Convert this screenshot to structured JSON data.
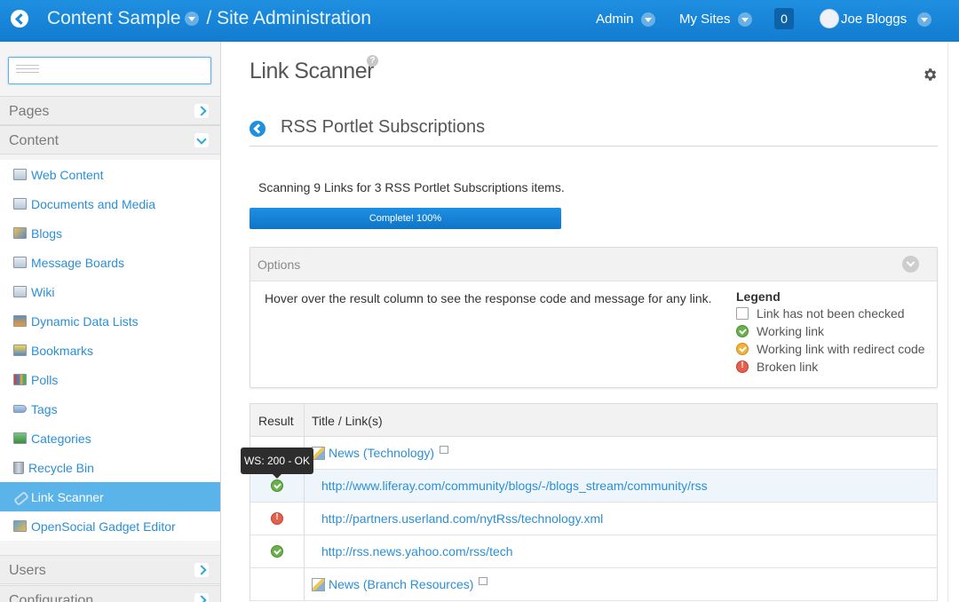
{
  "header": {
    "site_name": "Content Sample",
    "separator": "/",
    "section": "Site Administration",
    "admin_label": "Admin",
    "my_sites_label": "My Sites",
    "notification_count": "0",
    "user_name": "Joe Bloggs",
    "bar_color": "#1688d9"
  },
  "sidebar": {
    "search": {
      "value": "",
      "placeholder": ""
    },
    "pages_label": "Pages",
    "content_label": "Content",
    "content_items": [
      {
        "label": "Web Content",
        "icon": "web-content-icon"
      },
      {
        "label": "Documents and Media",
        "icon": "documents-icon"
      },
      {
        "label": "Blogs",
        "icon": "blogs-icon"
      },
      {
        "label": "Message Boards",
        "icon": "message-boards-icon"
      },
      {
        "label": "Wiki",
        "icon": "wiki-icon"
      },
      {
        "label": "Dynamic Data Lists",
        "icon": "dynamic-data-lists-icon"
      },
      {
        "label": "Bookmarks",
        "icon": "bookmarks-icon"
      },
      {
        "label": "Polls",
        "icon": "polls-icon"
      },
      {
        "label": "Tags",
        "icon": "tags-icon"
      },
      {
        "label": "Categories",
        "icon": "categories-icon"
      },
      {
        "label": "Recycle Bin",
        "icon": "recycle-bin-icon"
      },
      {
        "label": "Link Scanner",
        "icon": "link-scanner-icon",
        "active": true
      },
      {
        "label": "OpenSocial Gadget Editor",
        "icon": "opensocial-icon"
      }
    ],
    "users_label": "Users",
    "configuration_label": "Configuration",
    "active_color": "#5ab4ea"
  },
  "main": {
    "page_title": "Link Scanner",
    "help_glyph": "?",
    "section_title": "RSS Portlet Subscriptions",
    "scan_text": "Scanning 9 Links for 3 RSS Portlet Subscriptions items.",
    "progress": {
      "label": "Complete! 100%",
      "percent": 100
    },
    "options": {
      "header": "Options",
      "hint": "Hover over the result column to see the response code and message for any link.",
      "legend": {
        "title": "Legend",
        "items": [
          {
            "label": "Link has not been checked",
            "status": "unchecked"
          },
          {
            "label": "Working link",
            "status": "ok"
          },
          {
            "label": "Working link with redirect code",
            "status": "redirect"
          },
          {
            "label": "Broken link",
            "status": "broken"
          }
        ]
      }
    },
    "table": {
      "columns": [
        "Result",
        "Title / Link(s)"
      ],
      "rows": [
        {
          "type": "group",
          "title": "News (Technology)"
        },
        {
          "type": "link",
          "status": "ok",
          "url": "http://www.liferay.com/community/blogs/-/blogs_stream/community/rss"
        },
        {
          "type": "link",
          "status": "broken",
          "url": "http://partners.userland.com/nytRss/technology.xml"
        },
        {
          "type": "link",
          "status": "ok",
          "url": "http://rss.news.yahoo.com/rss/tech"
        },
        {
          "type": "group",
          "title": "News (Branch Resources)"
        }
      ]
    },
    "tooltip": "WS: 200 - OK"
  }
}
